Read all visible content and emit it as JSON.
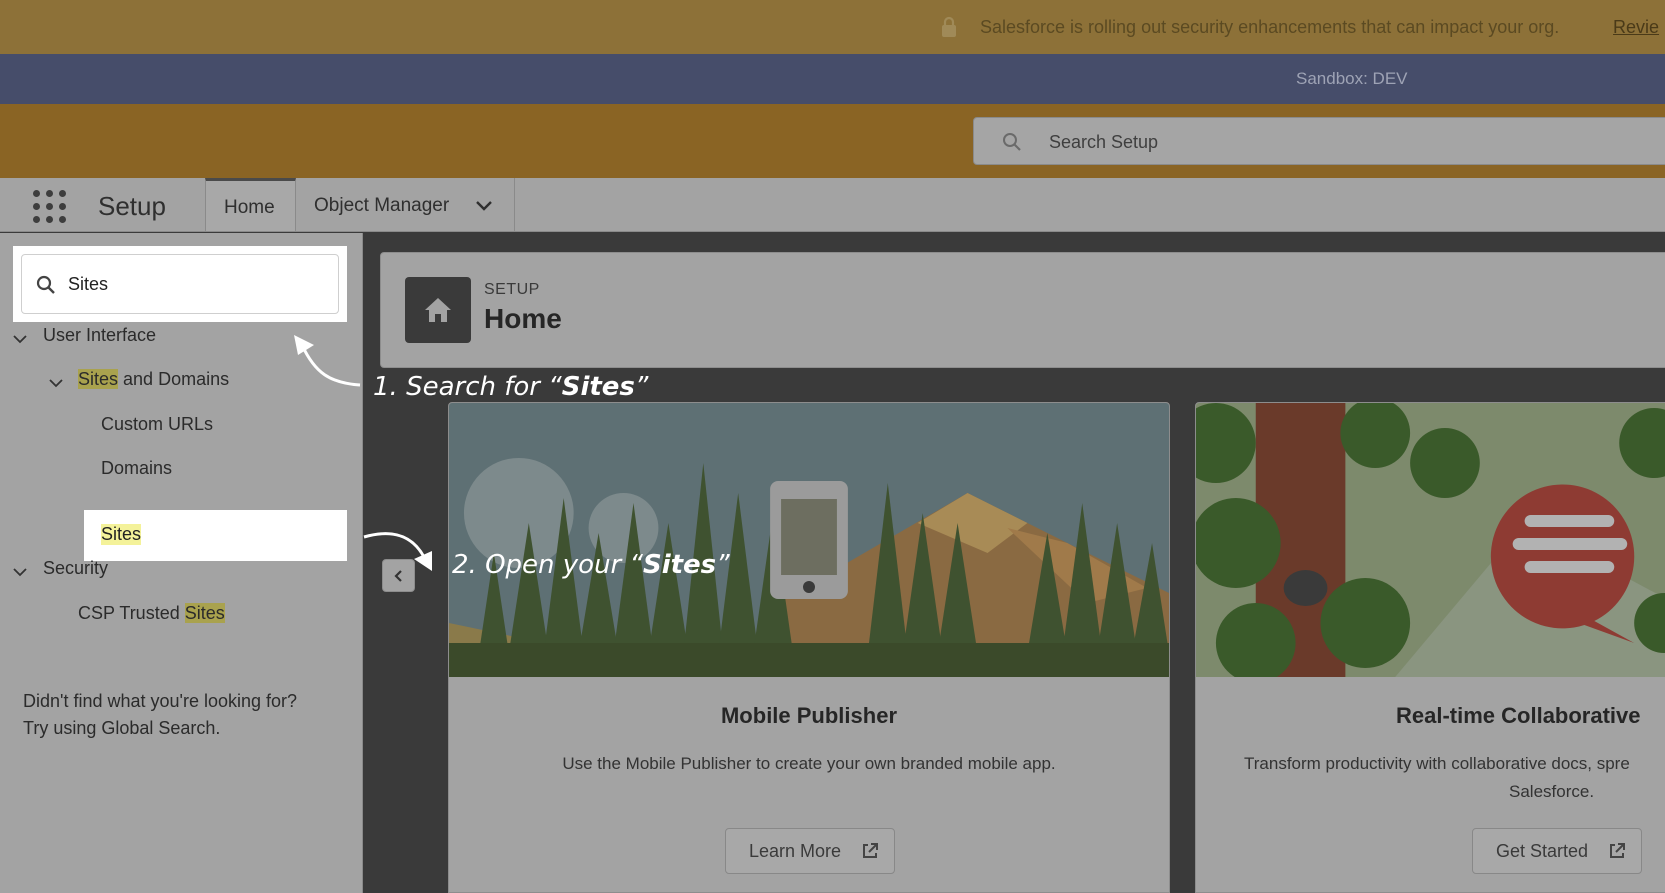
{
  "banner": {
    "message": "Salesforce is rolling out security enhancements that can impact your org.",
    "review_link": "Revie"
  },
  "sandbox": {
    "label": "Sandbox: DEV"
  },
  "global_search": {
    "placeholder": "Search Setup"
  },
  "nav": {
    "app_title": "Setup",
    "tabs": [
      {
        "label": "Home"
      },
      {
        "label": "Object Manager"
      }
    ]
  },
  "sidebar": {
    "quick_find_value": "Sites",
    "tree": {
      "user_interface": "User Interface",
      "sites_and_domains_hl": "Sites",
      "sites_and_domains_rest": " and Domains",
      "custom_urls": "Custom URLs",
      "domains": "Domains",
      "sites": "Sites",
      "security": "Security",
      "csp_prefix": "CSP Trusted ",
      "csp_hl": "Sites"
    },
    "not_found_line1": "Didn't find what you're looking for?",
    "not_found_line2": "Try using Global Search."
  },
  "header": {
    "eyebrow": "SETUP",
    "title": "Home"
  },
  "cards": [
    {
      "title": "Mobile Publisher",
      "description": "Use the Mobile Publisher to create your own branded mobile app.",
      "button": "Learn More"
    },
    {
      "title": "Real-time Collaborative",
      "description_line1": "Transform productivity with collaborative docs, spre",
      "description_line2": "Salesforce.",
      "button": "Get Started"
    }
  ],
  "annotations": {
    "step1_prefix": "1. Search for “",
    "step1_bold": "Sites",
    "step1_suffix": "”",
    "step2_prefix": "2. Open your “",
    "step2_bold": "Sites",
    "step2_suffix": "”"
  },
  "icons": {
    "lock": "lock-icon",
    "search": "search-icon",
    "app_launcher": "app-launcher-icon",
    "chevron": "chevron-down-icon",
    "home": "home-icon",
    "external": "external-link-icon"
  }
}
